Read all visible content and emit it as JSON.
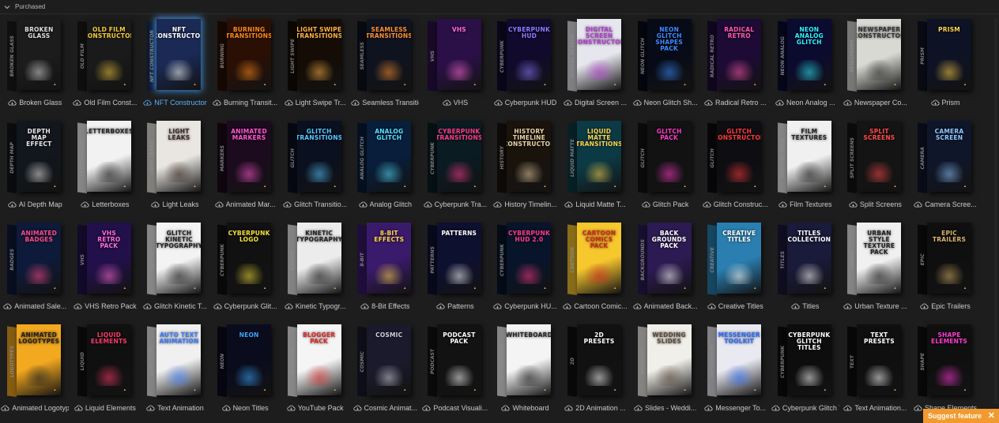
{
  "section": {
    "title": "Purchased"
  },
  "suggest": {
    "label": "Suggest feature",
    "close": "✕"
  },
  "items": [
    {
      "label": "Broken Glass",
      "box": "BROKEN GLASS",
      "side": "BROKEN GLASS",
      "bg": "#1c1c1c",
      "accent": "#dcdcdc"
    },
    {
      "label": "Old Film Const...",
      "box": "OLD FILM CONSTRUCTOR",
      "side": "OLD FILM",
      "bg": "#1a1a1a",
      "accent": "#f3c93f"
    },
    {
      "label": "NFT Constructor",
      "box": "NFT CONSTRUCTOR",
      "side": "NFT CONSTRUCTOR",
      "bg": "#1a2a55",
      "accent": "#ffffff"
    },
    {
      "label": "Burning Transit...",
      "box": "BURNING TRANSITIONS",
      "side": "BURNING",
      "bg": "#2a0f05",
      "accent": "#ff8a1c"
    },
    {
      "label": "Light Swipe Tr...",
      "box": "LIGHT SWIPE TRANSITIONS",
      "side": "LIGHT SWIPE",
      "bg": "#140c05",
      "accent": "#ffb347"
    },
    {
      "label": "Seamless Transitions",
      "box": "SEAMLESS TRANSITIONS",
      "side": "SEAMLESS",
      "bg": "#0f1320",
      "accent": "#ff9030"
    },
    {
      "label": "VHS",
      "box": "VHS",
      "side": "VHS",
      "bg": "#2b1048",
      "accent": "#ff6bd6"
    },
    {
      "label": "Cyberpunk HUD",
      "box": "CYBERPUNK HUD",
      "side": "CYBERPUNK",
      "bg": "#110a2c",
      "accent": "#8a7bff"
    },
    {
      "label": "Digital Screen ...",
      "box": "DIGITAL SCREEN CONSTRUCTOR",
      "side": "DIGITAL SCREEN",
      "bg": "#e6e6ee",
      "accent": "#b83ad6"
    },
    {
      "label": "Neon Glitch Sh...",
      "box": "NEON GLITCH SHAPES PACK",
      "side": "NEON GLITCH",
      "bg": "#070b18",
      "accent": "#3c8cff"
    },
    {
      "label": "Radical Retro ...",
      "box": "RADICAL RETRO",
      "side": "RADICAL RETRO",
      "bg": "#1d0b36",
      "accent": "#ff5aa8"
    },
    {
      "label": "Neon Analog ...",
      "box": "NEON ANALOG GLITCH",
      "side": "NEON ANALOG",
      "bg": "#0b0b30",
      "accent": "#2ef2ff"
    },
    {
      "label": "Newspaper Co...",
      "box": "NEWSPAPER CONSTRUCTOR",
      "side": "NEWSPAPER",
      "bg": "#d9d9d4",
      "accent": "#333333"
    },
    {
      "label": "Prism",
      "box": "PRISM",
      "side": "PRISM",
      "bg": "#0e1225",
      "accent": "#ffd54a"
    },
    {
      "label": "AI Depth Map",
      "box": "DEPTH MAP EFFECT",
      "side": "DEPTH MAP",
      "bg": "#12161d",
      "accent": "#e8e8e8"
    },
    {
      "label": "Letterboxes",
      "box": "LETTERBOXES",
      "side": "LETTERBOXES",
      "bg": "#f2f2f2",
      "accent": "#222222"
    },
    {
      "label": "Light Leaks",
      "box": "LIGHT LEAKS",
      "side": "LIGHT LEAKS",
      "bg": "#e9e6e1",
      "accent": "#3a2a20"
    },
    {
      "label": "Animated Mar...",
      "box": "ANIMATED MARKERS",
      "side": "MARKERS",
      "bg": "#1c0b1e",
      "accent": "#ff58d0"
    },
    {
      "label": "Glitch Transitio...",
      "box": "GLITCH TRANSITIONS",
      "side": "GLITCH",
      "bg": "#0a1020",
      "accent": "#5ac8ff"
    },
    {
      "label": "Analog Glitch",
      "box": "ANALOG GLITCH",
      "side": "ANALOG GLITCH",
      "bg": "#081e3a",
      "accent": "#58e0ff"
    },
    {
      "label": "Cyberpunk Tra...",
      "box": "CYBERPUNK TRANSITIONS",
      "side": "CYBERPUNK",
      "bg": "#0a1b22",
      "accent": "#ff3a8a"
    },
    {
      "label": "History Timelin...",
      "box": "HISTORY TIMELINE CONSTRUCTOR",
      "side": "HISTORY",
      "bg": "#1a130c",
      "accent": "#e8d2a6"
    },
    {
      "label": "Liquid Matte T...",
      "box": "LIQUID MATTE TRANSITIONS",
      "side": "LIQUID MATTE",
      "bg": "#0c3a44",
      "accent": "#ffd34a"
    },
    {
      "label": "Glitch Pack",
      "box": "GLITCH PACK",
      "side": "GLITCH",
      "bg": "#121212",
      "accent": "#ff3ac8"
    },
    {
      "label": "Glitch Construc...",
      "box": "GLITCH CONSTRUCTOR",
      "side": "GLITCH",
      "bg": "#0d0d12",
      "accent": "#ff3a3a"
    },
    {
      "label": "Film Textures",
      "box": "FILM TEXTURES",
      "side": "TEXTURE PACK",
      "bg": "#f0f0f0",
      "accent": "#222222"
    },
    {
      "label": "Split Screens",
      "box": "SPLIT SCREENS",
      "side": "SPLIT SCREENS",
      "bg": "#141414",
      "accent": "#ff4a4a"
    },
    {
      "label": "Camera Scree...",
      "box": "CAMERA SCREEN",
      "side": "CAMERA",
      "bg": "#10162a",
      "accent": "#8fc8ff"
    },
    {
      "label": "Animated Sale...",
      "box": "ANIMATED BADGES",
      "side": "BADGES",
      "bg": "#0e1a3a",
      "accent": "#ff4a8a"
    },
    {
      "label": "VHS Retro Pack",
      "box": "VHS RETRO PACK",
      "side": "VHS",
      "bg": "#22104a",
      "accent": "#ff6bd6"
    },
    {
      "label": "Glitch Kinetic T...",
      "box": "GLITCH KINETIC TYPOGRAPHY",
      "side": "GLITCH",
      "bg": "#f3f3f3",
      "accent": "#222222"
    },
    {
      "label": "Cyberpunk Glit...",
      "box": "CYBERPUNK LOGO",
      "side": "CYBERPUNK",
      "bg": "#111111",
      "accent": "#f5e13a"
    },
    {
      "label": "Kinetic Typogr...",
      "box": "KINETIC TYPOGRAPHY",
      "side": "KINETIC",
      "bg": "#ececec",
      "accent": "#222222"
    },
    {
      "label": "8-Bit Effects",
      "box": "8-BIT EFFECTS",
      "side": "8-BIT",
      "bg": "#3a1a6a",
      "accent": "#ffd84a"
    },
    {
      "label": "Patterns",
      "box": "PATTERNS",
      "side": "PATTERNS",
      "bg": "#0e1030",
      "accent": "#ffffff"
    },
    {
      "label": "Cyberpunk HU...",
      "box": "CYBERPUNK HUD 2.0",
      "side": "CYBERPUNK",
      "bg": "#07142a",
      "accent": "#ff3a8a"
    },
    {
      "label": "Cartoon Comic...",
      "box": "CARTOON COMICS PACK",
      "side": "CARTOON",
      "bg": "#f7c72e",
      "accent": "#d6241e"
    },
    {
      "label": "Animated Back...",
      "box": "BACK GROUNDS PACK",
      "side": "BACKGROUNDS",
      "bg": "#2c1a52",
      "accent": "#ffffff"
    },
    {
      "label": "Creative Titles",
      "box": "CREATIVE TITLES",
      "side": "CREATIVE",
      "bg": "#2a7fb0",
      "accent": "#ffffff"
    },
    {
      "label": "Titles",
      "box": "TITLES COLLECTION",
      "side": "TITLES",
      "bg": "#1a1a3a",
      "accent": "#ffffff"
    },
    {
      "label": "Urban Texture ...",
      "box": "URBAN STYLE TEXTURE PACK",
      "side": "URBAN",
      "bg": "#f0f0f0",
      "accent": "#222222"
    },
    {
      "label": "Epic Trailers",
      "box": "EPIC TRAILERS",
      "side": "EPIC",
      "bg": "#0f0f0f",
      "accent": "#d8b46a"
    },
    {
      "label": "Animated Logotypes",
      "box": "ANIMATED LOGOTYPES",
      "side": "LOGOTYPES",
      "bg": "#f2a81f",
      "accent": "#222222"
    },
    {
      "label": "Liquid Elements",
      "box": "LIQUID ELEMENTS",
      "side": "LIQUID",
      "bg": "#101010",
      "accent": "#ff3a6a"
    },
    {
      "label": "Text Animation",
      "box": "AUTO TEXT ANIMATION",
      "side": "AUTO TEXT",
      "bg": "#f0f0f0",
      "accent": "#3a7cff"
    },
    {
      "label": "Neon Titles",
      "box": "NEON",
      "side": "NEON",
      "bg": "#0a0c1e",
      "accent": "#3aa8ff"
    },
    {
      "label": "YouTube Pack",
      "box": "BLOGGER PACK",
      "side": "BLOGGER",
      "bg": "#f5f5f5",
      "accent": "#e02828"
    },
    {
      "label": "Cosmic Animat...",
      "box": "COSMIC",
      "side": "COSMIC",
      "bg": "#1a1a2c",
      "accent": "#cfcfdf"
    },
    {
      "label": "Podcast Visuali...",
      "box": "PODCAST PACK",
      "side": "PODCAST",
      "bg": "#121212",
      "accent": "#ffffff"
    },
    {
      "label": "Whiteboard",
      "box": "WHITEBOARD",
      "side": "WHITEBOARD",
      "bg": "#f4f4f4",
      "accent": "#222222"
    },
    {
      "label": "2D Animation ...",
      "box": "2D PRESETS",
      "side": "2D",
      "bg": "#111111",
      "accent": "#ffffff"
    },
    {
      "label": "Slides - Weddi...",
      "box": "WEDDING SLIDES",
      "side": "WEDDING",
      "bg": "#f1efe9",
      "accent": "#5a4a3a"
    },
    {
      "label": "Messenger To...",
      "box": "MESSENGER TOOLKIT",
      "side": "MESSENGER",
      "bg": "#e9e9f2",
      "accent": "#2a6dff"
    },
    {
      "label": "Cyberpunk Glitch T...",
      "box": "CYBERPUNK GLITCH TITLES",
      "side": "CYBERPUNK",
      "bg": "#0d0d0d",
      "accent": "#ffffff"
    },
    {
      "label": "Text Animation...",
      "box": "TEXT PRESETS",
      "side": "TEXT",
      "bg": "#0f0f0f",
      "accent": "#ffffff"
    },
    {
      "label": "Shape Elements",
      "box": "SHAPE ELEMENTS",
      "side": "SHAPE",
      "bg": "#0f0f0f",
      "accent": "#ff3ad6"
    }
  ],
  "selected_index": 2,
  "colors": {
    "background": "#1d1d1d",
    "text": "#c9c9c9",
    "selected": "#5cb0ff",
    "suggest": "#f29a2e"
  },
  "icons": {
    "section_toggle": "chevron-down-icon",
    "item_status": "cloud-download-icon",
    "close": "close-icon"
  }
}
